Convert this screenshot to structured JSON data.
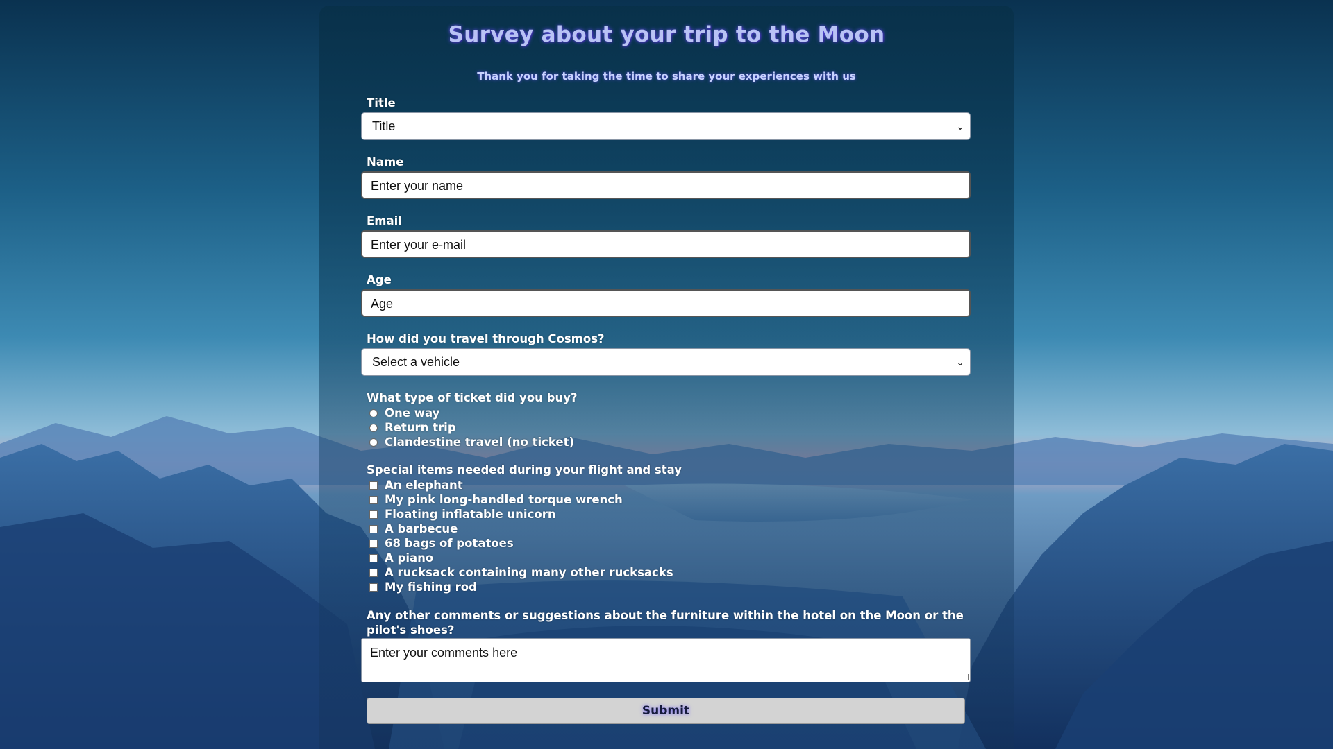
{
  "page": {
    "title": "Survey about your trip to the Moon",
    "subtitle": "Thank you for taking the time to share your experiences with us"
  },
  "form": {
    "title_field": {
      "label": "Title",
      "selected": "Title"
    },
    "name_field": {
      "label": "Name",
      "placeholder": "Enter your name"
    },
    "email_field": {
      "label": "Email",
      "placeholder": "Enter your e-mail"
    },
    "age_field": {
      "label": "Age",
      "placeholder": "Age"
    },
    "vehicle_field": {
      "label": "How did you travel through Cosmos?",
      "selected": "Select a vehicle"
    },
    "ticket": {
      "label": "What type of ticket did you buy?",
      "options": [
        "One way",
        "Return trip",
        "Clandestine travel (no ticket)"
      ]
    },
    "items": {
      "label": "Special items needed during your flight and stay",
      "options": [
        "An elephant",
        "My pink long-handled torque wrench",
        "Floating inflatable unicorn",
        "A barbecue",
        "68 bags of potatoes",
        "A piano",
        "A rucksack containing many other rucksacks",
        "My fishing rod"
      ]
    },
    "comments": {
      "label": "Any other comments or suggestions about the furniture within the hotel on the Moon or the pilot's shoes?",
      "placeholder": "Enter your comments here"
    },
    "submit_label": "Submit"
  },
  "colors": {
    "title_text": "#b9c3f5",
    "title_glow": "#5a4be0",
    "panel": "#083048",
    "submit_bg": "#d3d3d3"
  },
  "icons": {
    "select_chevron": "chevron-down-icon"
  }
}
